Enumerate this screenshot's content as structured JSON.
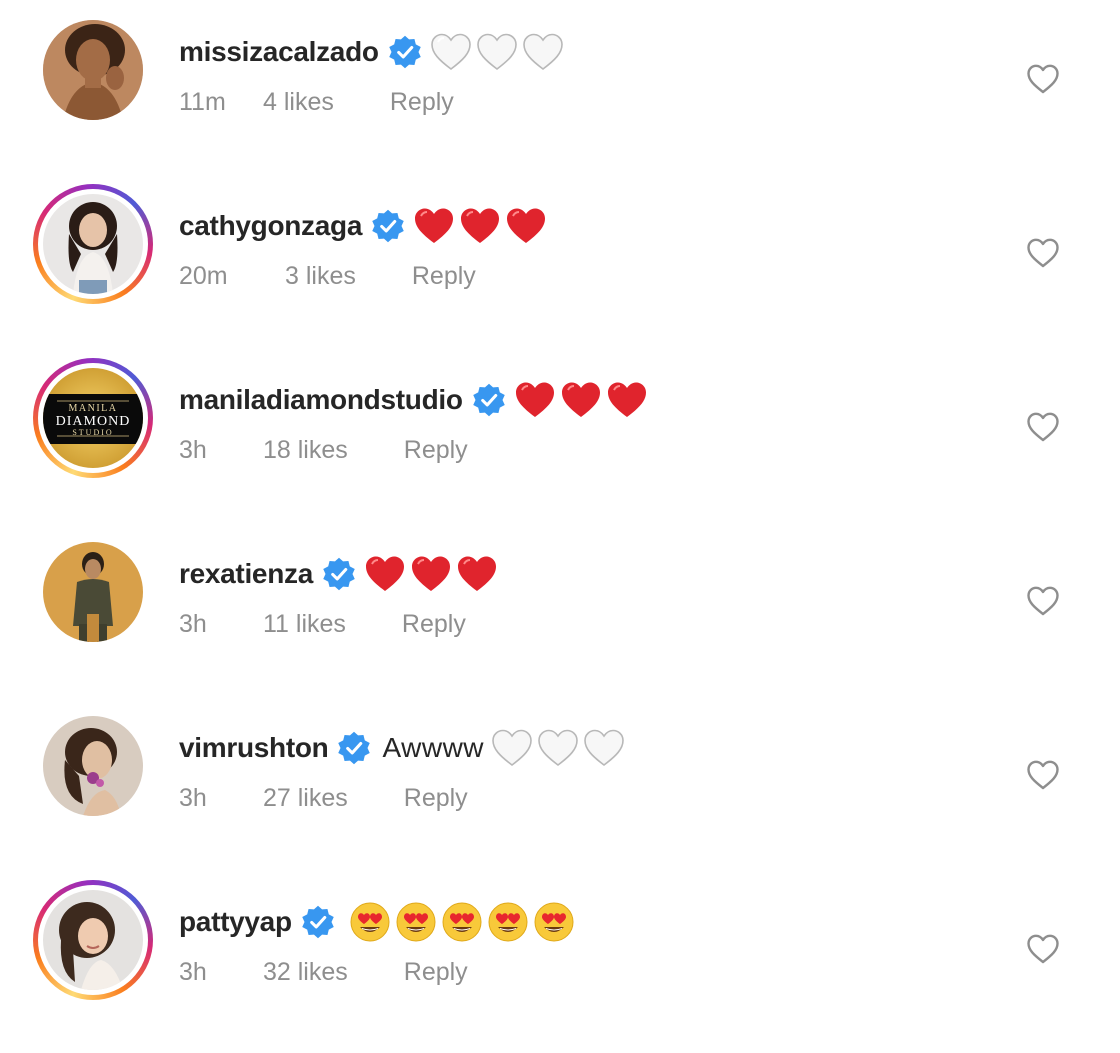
{
  "comments": [
    {
      "username": "missizacalzado",
      "verified": true,
      "text": "",
      "emojis": [
        "white-heart",
        "white-heart",
        "white-heart"
      ],
      "time": "11m",
      "likes": "4 likes",
      "reply": "Reply",
      "avatar": "avatar-missizacalzado",
      "story_ring": false
    },
    {
      "username": "cathygonzaga",
      "verified": true,
      "text": "",
      "emojis": [
        "red-heart",
        "red-heart",
        "red-heart"
      ],
      "time": "20m",
      "likes": "3 likes",
      "reply": "Reply",
      "avatar": "avatar-cathygonzaga",
      "story_ring": true
    },
    {
      "username": "maniladiamondstudio",
      "verified": true,
      "text": "",
      "emojis": [
        "red-heart",
        "red-heart",
        "red-heart"
      ],
      "time": "3h",
      "likes": "18 likes",
      "reply": "Reply",
      "avatar": "avatar-maniladiamondstudio",
      "avatar_logo": {
        "line1": "MANILA",
        "line2": "DIAMOND",
        "line3": "STUDIO"
      },
      "story_ring": true
    },
    {
      "username": "rexatienza",
      "verified": true,
      "text": "",
      "emojis": [
        "red-heart",
        "red-heart",
        "red-heart"
      ],
      "time": "3h",
      "likes": "11 likes",
      "reply": "Reply",
      "avatar": "avatar-rexatienza",
      "story_ring": false
    },
    {
      "username": "vimrushton",
      "verified": true,
      "text": "Awwww",
      "emojis": [
        "white-heart",
        "white-heart",
        "white-heart"
      ],
      "time": "3h",
      "likes": "27 likes",
      "reply": "Reply",
      "avatar": "avatar-vimrushton",
      "story_ring": false
    },
    {
      "username": "pattyyap",
      "verified": true,
      "text": "",
      "emojis": [
        "heart-eyes-face",
        "heart-eyes-face",
        "heart-eyes-face",
        "heart-eyes-face",
        "heart-eyes-face"
      ],
      "time": "3h",
      "likes": "32 likes",
      "reply": "Reply",
      "avatar": "avatar-pattyyap",
      "story_ring": true
    }
  ],
  "colors": {
    "text": "#262626",
    "meta": "#8e8e8e",
    "verified_blue": "#3897f0",
    "red_heart": "#e0242d",
    "like_outline": "#8e8e8e"
  },
  "icons": {
    "verified": "verified-badge-icon",
    "like": "heart-outline-icon"
  }
}
